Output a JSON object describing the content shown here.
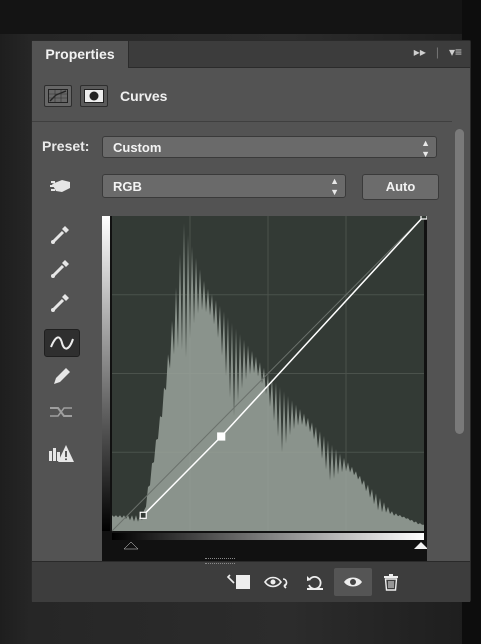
{
  "panel": {
    "tab_label": "Properties",
    "adjustment_title": "Curves"
  },
  "preset": {
    "label": "Preset:",
    "value": "Custom"
  },
  "channel": {
    "value": "RGB",
    "auto_label": "Auto"
  },
  "colors": {
    "panel_bg": "#535353",
    "titlebar_bg": "#3c3c3c",
    "graph_bg": "#333a35",
    "histogram": "#9aa39b",
    "curve": "#ffffff"
  },
  "tools": [
    {
      "icon": "on-image-adjust-icon",
      "active": false
    },
    {
      "icon": "black-point-eyedropper-icon",
      "active": false
    },
    {
      "icon": "gray-point-eyedropper-icon",
      "active": false
    },
    {
      "icon": "white-point-eyedropper-icon",
      "active": false
    },
    {
      "icon": "curve-edit-points-icon",
      "active": true
    },
    {
      "icon": "pencil-draw-icon",
      "active": false
    },
    {
      "icon": "smooth-curve-icon",
      "active": false
    },
    {
      "icon": "clipping-warning-icon",
      "active": false
    }
  ],
  "curve_points": [
    {
      "input": 0.1,
      "output": 0.05
    },
    {
      "input": 0.35,
      "output": 0.3
    },
    {
      "input": 1.0,
      "output": 1.0
    }
  ],
  "bottom_icons": [
    "clip-to-layer-icon",
    "view-previous-state-icon",
    "reset-icon",
    "toggle-visibility-icon",
    "delete-icon"
  ]
}
